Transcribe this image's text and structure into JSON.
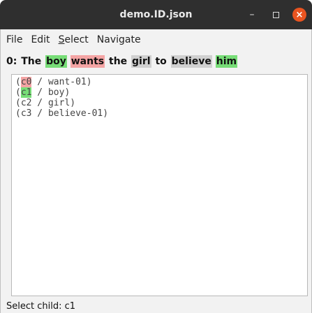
{
  "window": {
    "title": "demo.ID.json",
    "controls": {
      "minimize": "–",
      "maximize": "",
      "close": "×"
    }
  },
  "menu": [
    {
      "label": "File"
    },
    {
      "label": "Edit"
    },
    {
      "label_prefix": "",
      "label_mnemonic": "S",
      "label_rest": "elect"
    },
    {
      "label": "Navigate"
    }
  ],
  "sentence": {
    "index": "0:",
    "tokens": [
      {
        "text": "The",
        "highlight": "none"
      },
      {
        "text": "boy",
        "highlight": "green"
      },
      {
        "text": "wants",
        "highlight": "pink"
      },
      {
        "text": "the",
        "highlight": "none"
      },
      {
        "text": "girl",
        "highlight": "gray"
      },
      {
        "text": "to",
        "highlight": "none"
      },
      {
        "text": "believe",
        "highlight": "gray"
      },
      {
        "text": "him",
        "highlight": "green"
      }
    ]
  },
  "editor": {
    "lines": [
      {
        "open": "(",
        "var": "c0",
        "var_highlight": "pink",
        "rest": " / want-01)"
      },
      {
        "open": "(",
        "var": "c1",
        "var_highlight": "green",
        "rest": " / boy)"
      },
      {
        "open": "(",
        "var": "c2",
        "var_highlight": "none",
        "rest": " / girl)"
      },
      {
        "open": "(",
        "var": "c3",
        "var_highlight": "none",
        "rest": " / believe-01)"
      }
    ]
  },
  "status": {
    "text": "Select child: c1"
  },
  "colors": {
    "titlebar_bg": "#2f2f2f",
    "close_button": "#e95420",
    "highlight_green": "#77dd77",
    "highlight_pink": "#f4a4a4",
    "highlight_gray": "#d0d0d0"
  }
}
